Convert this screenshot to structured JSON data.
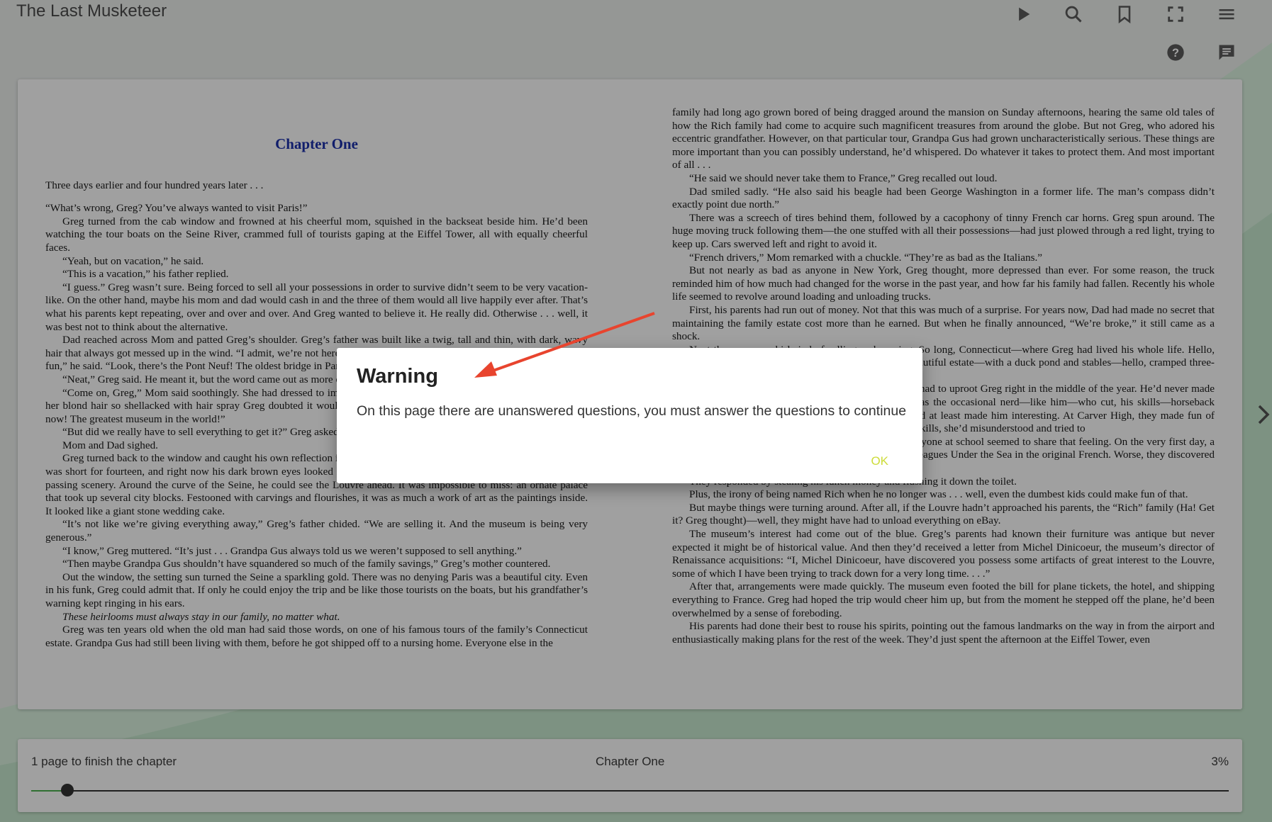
{
  "app": {
    "title": "The Last Musketeer"
  },
  "toolbar": {
    "play_icon": "play-icon",
    "search_icon": "search-icon",
    "bookmark_icon": "bookmark-icon",
    "fullscreen_icon": "fullscreen-icon",
    "menu_icon": "menu-icon",
    "help_icon": "help-icon",
    "notes_icon": "notes-icon"
  },
  "left_page": {
    "chapter_title": "Chapter One",
    "paragraphs": [
      "Three days earlier and four hundred years later . . .",
      "“What’s wrong, Greg? You’ve always wanted to visit Paris!”",
      "Greg turned from the cab window and frowned at his cheerful mom, squished in the backseat beside him. He’d been watching the tour boats on the Seine River, crammed full of tourists gaping at the Eiffel Tower, all with equally cheerful faces.",
      "“Yeah, but on vacation,” he said.",
      "“This is a vacation,” his father replied.",
      "“I guess.” Greg wasn’t sure. Being forced to sell all your possessions in order to survive didn’t seem to be very vacation-like. On the other hand, maybe his mom and dad would cash in and the three of them would all live happily ever after. That’s what his parents kept repeating, over and over and over. And Greg wanted to believe it. He really did. Otherwise . . . well, it was best not to think about the alternative.",
      "Dad reached across Mom and patted Greg’s shoulder. Greg’s father was built like a twig, tall and thin, with dark, wavy hair that always got messed up in the wind. “I admit, we’re not here under the best circumstances, but we can still have some fun,” he said. “Look, there’s the Pont Neuf! The oldest bridge in Paris. It’s more than four hundred years ago!”",
      "“Neat,” Greg said. He meant it, but the word came out as more of a sigh.",
      "“Come on, Greg,” Mom said soothingly. She had dressed to impress for the day, in her fanciest clothes and tallest heels, her blond hair so shellacked with hair spray Greg doubted it would move in a hurricane. “We’re going to the Louvre right now! The greatest museum in the world!”",
      "“But did we really have to sell everything to get it?” Greg asked.",
      "Mom and Dad sighed.",
      "Greg turned back to the window and caught his own reflection in the glass. He was a small boy with brown curls—but he was short for fourteen, and right now his dark brown eyes looked like a sad puppy’s. Yikes. He shifted his gaze back to the passing scenery. Around the curve of the Seine, he could see the Louvre ahead. It was impossible to miss: an ornate palace that took up several city blocks. Festooned with carvings and flourishes, it was as much a work of art as the paintings inside. It looked like a giant stone wedding cake.",
      "“It’s not like we’re giving everything away,” Greg’s father chided. “We are selling it. And the museum is being very generous.”",
      "“I know,” Greg muttered. “It’s just . . . Grandpa Gus always told us we weren’t supposed to sell anything.”",
      "“Then maybe Grandpa Gus shouldn’t have squandered so much of the family savings,” Greg’s mother countered.",
      "Out the window, the setting sun turned the Seine a sparkling gold. There was no denying Paris was a beautiful city. Even in his funk, Greg could admit that. If only he could enjoy the trip and be like those tourists on the boats, but his grandfather’s warning kept ringing in his ears.",
      "These heirlooms must always stay in our family, no matter what.",
      "Greg was ten years old when the old man had said those words, on one of his famous tours of the family’s Connecticut estate. Grandpa Gus had still been living with them, before he got shipped off to a nursing home. Everyone else in the"
    ]
  },
  "right_page": {
    "paragraphs": [
      "family had long ago grown bored of being dragged around the mansion on Sunday afternoons, hearing the same old tales of how the Rich family had come to acquire such magnificent treasures from around the globe. But not Greg, who adored his eccentric grandfather. However, on that particular tour, Grandpa Gus had grown uncharacteristically serious. These things are more important than you can possibly understand, he’d whispered. Do whatever it takes to protect them. And most important of all . . .",
      "“He said we should never take them to France,” Greg recalled out loud.",
      "Dad smiled sadly. “He also said his beagle had been George Washington in a former life. The man’s compass didn’t exactly point due north.”",
      "There was a screech of tires behind them, followed by a cacophony of tinny French car horns. Greg spun around. The huge moving truck following them—the one stuffed with all their possessions—had just plowed through a red light, trying to keep up. Cars swerved left and right to avoid it.",
      "“French drivers,” Mom remarked with a chuckle. “They’re as bad as the Italians.”",
      "But not nearly as bad as anyone in New York, Greg thought, more depressed than ever. For some reason, the truck reminded him of how much had changed for the worse in the past year, and how far his family had fallen. Recently his whole life seemed to revolve around loading and unloading trucks.",
      "First, his parents had run out of money. Not that this was much of a surprise. For years now, Dad had made no secret that maintaining the family estate cost more than he earned. But when he finally announced, “We’re broke,” it still came as a shock.",
      "Next there was a whirlwind of selling and moving. So long, Connecticut—where Greg had lived his whole life. Hello, New York—Queens, in fact—hello, Queens. So long, beautiful estate—with a duck pond and stables—hello, cramped three-room apartment. So long, private school—hello, public.",
      "Worst of all, it was the middle of eighth grade. They had to uproot Greg right in the middle of the year. He’d never made any truly close friends at Wellington Prep. But there was the occasional nerd—like him—who cut, his skills—horseback riding, fluent French, fencing (he was on the team)—had at least made him interesting. At Carver High, they made fun of him. When someone at the lunchroom about his fencing skills, she’d misunderstood and tried to",
      "He’d always felt a bit small for his age, but now everyone at school seemed to share that feeling. On the very first day, a group of bullies had discovered he was reading 20,000 Leagues Under the Sea in the original French. Worse, they discovered he was reading it just for fun.",
      "They responded by stealing his lunch money and flushing it down the toilet.",
      "Plus, the irony of being named Rich when he no longer was . . . well, even the dumbest kids could make fun of that.",
      "But maybe things were turning around. After all, if the Louvre hadn’t approached his parents, the “Rich” family (Ha! Get it? Greg thought)—well, they might have had to unload everything on eBay.",
      "The museum’s interest had come out of the blue. Greg’s parents had known their furniture was antique but never expected it might be of historical value. And then they’d received a letter from Michel Dinicoeur, the museum’s director of Renaissance acquisitions: “I, Michel Dinicoeur, have discovered you possess some artifacts of great interest to the Louvre, some of which I have been trying to track down for a very long time. . . .”",
      "After that, arrangements were made quickly. The museum even footed the bill for plane tickets, the hotel, and shipping everything to France. Greg had hoped the trip would cheer him up, but from the moment he stepped off the plane, he’d been overwhelmed by a sense of foreboding.",
      "His parents had done their best to rouse his spirits, pointing out the famous landmarks on the way in from the airport and enthusiastically making plans for the rest of the week. They’d just spent the afternoon at the Eiffel Tower, even"
    ]
  },
  "footer": {
    "pages_left": "1 page to finish the chapter",
    "chapter": "Chapter One",
    "percent": "3%",
    "progress": 0.03
  },
  "dialog": {
    "title": "Warning",
    "message": "On this page there are unanswered questions, you must answer the questions to continue",
    "ok_label": "OK"
  },
  "colors": {
    "accent": "#cddc39",
    "chapter": "#1c2fa8",
    "progress": "#4caf50"
  }
}
